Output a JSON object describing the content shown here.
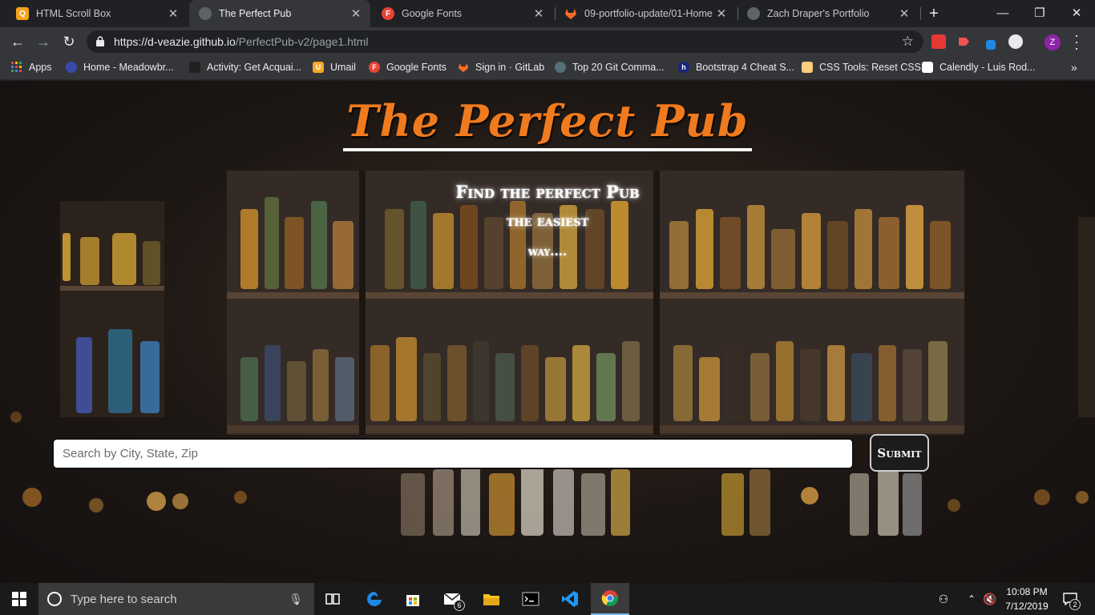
{
  "browser": {
    "tabs": [
      {
        "title": "HTML Scroll Box",
        "icon": "html-scroll-box-favicon",
        "color": "#f6a21a",
        "active": false
      },
      {
        "title": "The Perfect Pub",
        "icon": "globe-favicon",
        "color": "#9aa0a6",
        "active": true
      },
      {
        "title": "Google Fonts",
        "icon": "google-fonts-favicon",
        "color": "#ea4335",
        "active": false
      },
      {
        "title": "09-portfolio-update/01-Home",
        "icon": "gitlab-favicon",
        "color": "#fc6d26",
        "active": false
      },
      {
        "title": "Zach Draper's Portfolio",
        "icon": "globe-favicon",
        "color": "#9aa0a6",
        "active": false
      }
    ],
    "url_host": "https://d-veazie.github.io",
    "url_path": "/PerfectPub-v2/page1.html",
    "profile_initial": "Z",
    "bookmarks": [
      {
        "label": "Apps",
        "icon": "apps-grid-icon"
      },
      {
        "label": "Home - Meadowbr...",
        "icon": "meadowbrook-icon"
      },
      {
        "label": "Activity: Get Acquai...",
        "icon": "book-icon"
      },
      {
        "label": "Umail",
        "icon": "umail-icon"
      },
      {
        "label": "Google Fonts",
        "icon": "google-fonts-icon"
      },
      {
        "label": "Sign in · GitLab",
        "icon": "gitlab-icon"
      },
      {
        "label": "Top 20 Git Comma...",
        "icon": "git-icon"
      },
      {
        "label": "Bootstrap 4 Cheat S...",
        "icon": "bootstrap-icon"
      },
      {
        "label": "CSS Tools: Reset CSS",
        "icon": "css-tools-icon"
      },
      {
        "label": "Calendly - Luis Rod...",
        "icon": "calendly-icon"
      }
    ]
  },
  "page": {
    "title": "The Perfect Pub",
    "tagline": [
      "Find the perfect Pub",
      "the easiest",
      "way...."
    ],
    "search_placeholder": "Search by City, State, Zip",
    "submit_label": "Submit"
  },
  "taskbar": {
    "search_placeholder": "Type here to search",
    "mail_badge": "6",
    "time": "10:08 PM",
    "date": "7/12/2019",
    "notification_count": "2"
  },
  "colors": {
    "title_orange": "#f07a1e",
    "chrome_dark": "#202124",
    "toolbar": "#35363a"
  }
}
